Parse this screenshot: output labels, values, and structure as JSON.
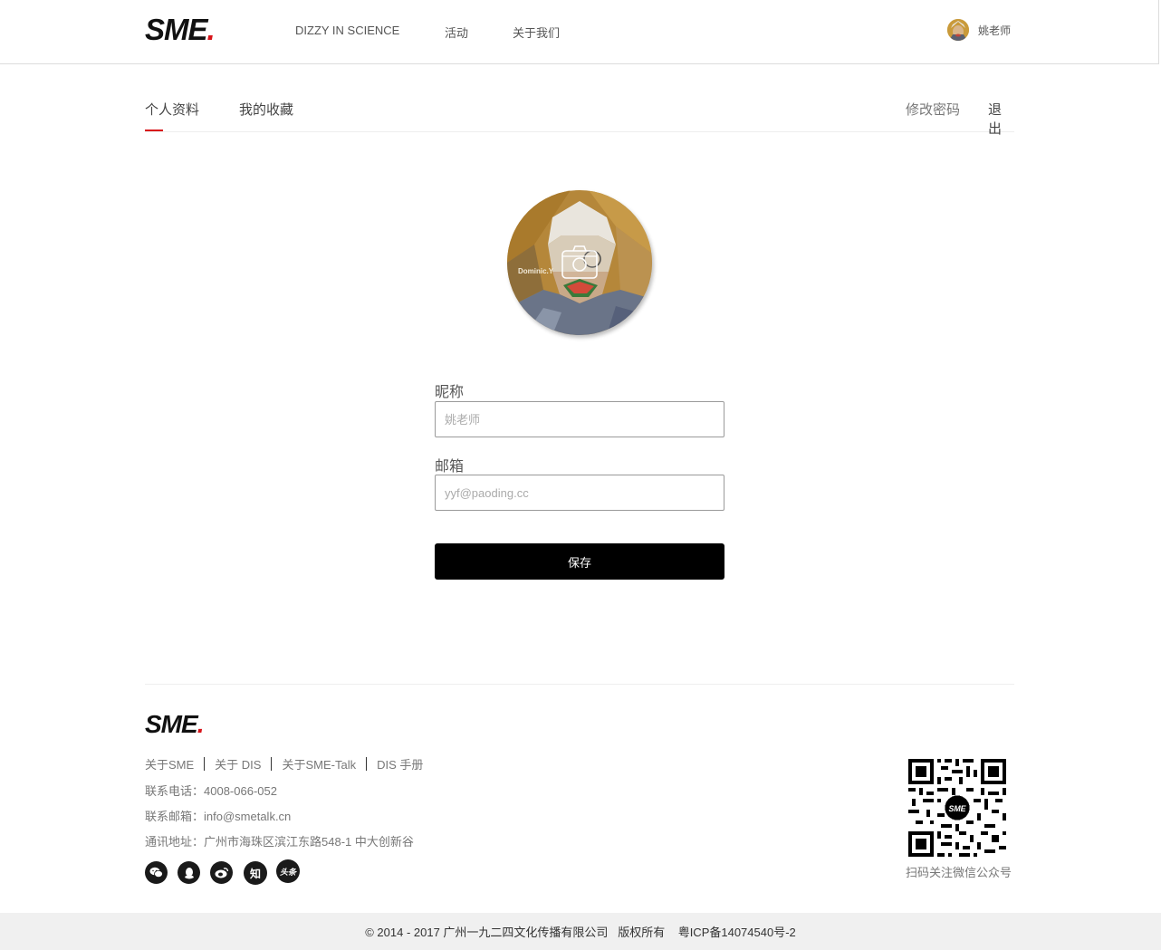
{
  "header": {
    "logo_text": "SME",
    "logo_dot": ".",
    "nav": [
      {
        "label": "DIZZY IN SCIENCE"
      },
      {
        "label": "活动"
      },
      {
        "label": "关于我们"
      }
    ],
    "user_name": "姚老师"
  },
  "tabs": {
    "profile": "个人资料",
    "favorites": "我的收藏",
    "change_password": "修改密码",
    "logout": "退出"
  },
  "avatar": {
    "watermark": "Dominic.Y"
  },
  "form": {
    "nickname_label": "昵称",
    "nickname_placeholder": "姚老师",
    "email_label": "邮箱",
    "email_placeholder": "yyf@paoding.cc",
    "save_label": "保存"
  },
  "footer": {
    "logo_text": "SME",
    "logo_dot": ".",
    "links": [
      "关于SME",
      "关于 DIS",
      "关于SME-Talk",
      "DIS 手册"
    ],
    "phone": "联系电话：4008-066-052",
    "email": "联系邮箱：info@smetalk.cn",
    "address": "通讯地址：广州市海珠区滨江东路548-1 中大创新谷",
    "social": {
      "zhihu": "知",
      "toutiao": "头条"
    },
    "qr_caption": "扫码关注微信公众号",
    "qr_center_text": "SME",
    "copyright": "© 2014 - 2017 广州一九二四文化传播有限公司   版权所有    粤ICP备14074540号-2"
  },
  "colors": {
    "accent": "#d8141a",
    "button_bg": "#000000",
    "copyright_bg": "#f0f0f0"
  }
}
